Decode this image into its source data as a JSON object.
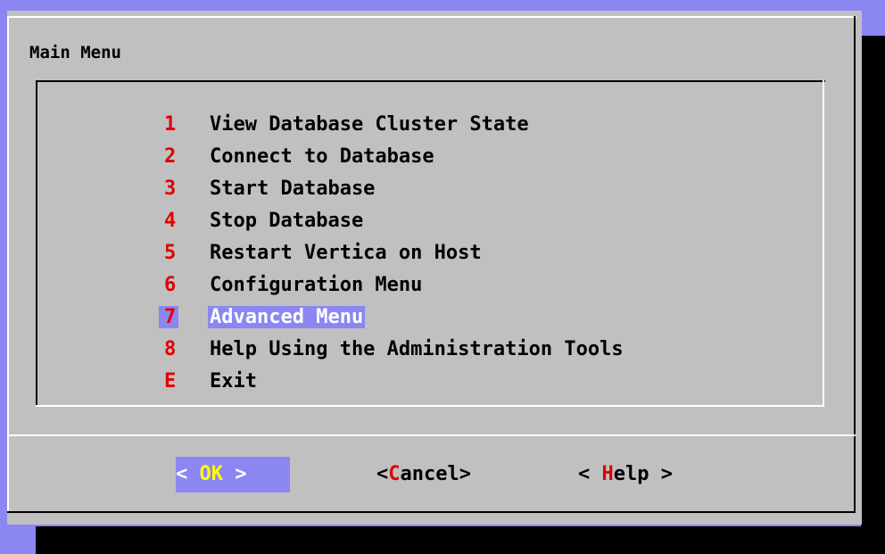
{
  "dialog": {
    "title": "Main Menu",
    "menu_items": [
      {
        "tag": "1",
        "label": "View Database Cluster State"
      },
      {
        "tag": "2",
        "label": "Connect to Database"
      },
      {
        "tag": "3",
        "label": "Start Database"
      },
      {
        "tag": "4",
        "label": "Stop Database"
      },
      {
        "tag": "5",
        "label": "Restart Vertica on Host"
      },
      {
        "tag": "6",
        "label": "Configuration Menu"
      },
      {
        "tag": "7",
        "label": "Advanced Menu"
      },
      {
        "tag": "8",
        "label": "Help Using the Administration Tools"
      },
      {
        "tag": "E",
        "label": "Exit"
      }
    ],
    "selected_tag": "7",
    "buttons": {
      "ok": {
        "left": "< ",
        "hot": "OK",
        "right": " >"
      },
      "cancel": {
        "left": "<",
        "hot": "C",
        "right": "ancel>"
      },
      "help": {
        "left": "< ",
        "hot": "H",
        "right": "elp >"
      }
    }
  },
  "colors": {
    "screen_bg": "#8b86f2",
    "dialog_bg": "#c0c0c0",
    "highlight_bg": "#8b86f2",
    "hotkey_red": "#e00000",
    "hotkey_yellow": "#ffff00",
    "text": "#000000",
    "terminal_black": "#000000"
  }
}
